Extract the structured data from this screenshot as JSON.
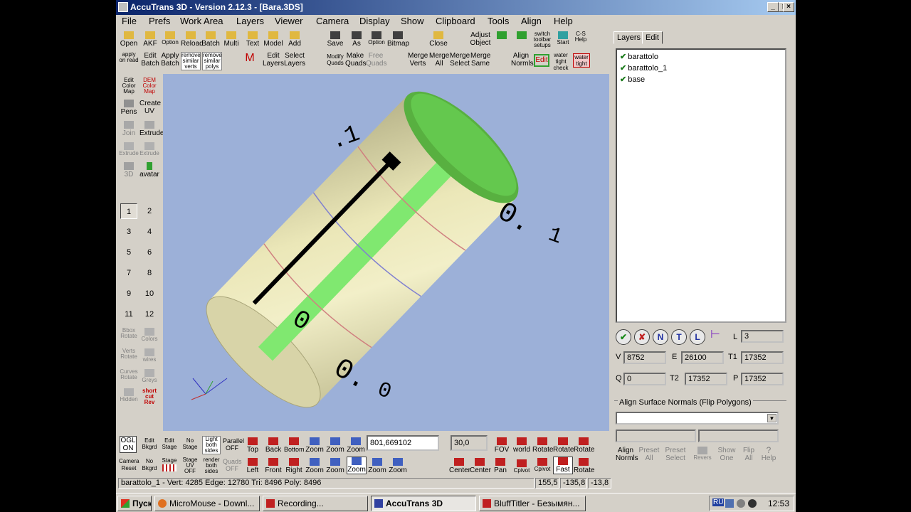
{
  "window": {
    "title": "AccuTrans 3D - Version 2.12.3 - [Bara.3DS]"
  },
  "menu": [
    "File",
    "Prefs",
    "Work Area",
    "Layers",
    "Viewer",
    "Camera",
    "Display",
    "Show",
    "Clipboard",
    "Tools",
    "Align",
    "Help"
  ],
  "toolbar_top_row1": [
    {
      "label": "Open",
      "icon": "folder-icon"
    },
    {
      "label": "AKF",
      "icon": "folder-icon"
    },
    {
      "label": "Option",
      "icon": "folder-icon"
    },
    {
      "label": "Reload",
      "icon": "folder-icon"
    },
    {
      "label": "Batch",
      "icon": "folder-icon"
    },
    {
      "label": "Multi",
      "icon": "folder-icon"
    },
    {
      "label": "Text",
      "icon": "folder-icon"
    },
    {
      "label": "Model",
      "icon": "folder-icon"
    },
    {
      "label": "Add",
      "icon": "folder-icon"
    },
    {
      "label": "Save",
      "icon": "disk-icon"
    },
    {
      "label": "As",
      "icon": "disk-icon"
    },
    {
      "label": "Option",
      "icon": "disk-icon"
    },
    {
      "label": "Bitmap",
      "icon": "disk-icon"
    },
    {
      "label": "Close",
      "icon": "folder-icon"
    },
    {
      "label": "Adjust Object",
      "icon": "adjust-icon"
    },
    {
      "label": "switch toolbar setups",
      "icon": "switch-icon"
    },
    {
      "label": "Start",
      "icon": "start-icon"
    },
    {
      "label": "C-S Help",
      "icon": "help-icon"
    }
  ],
  "toolbar_top_row2": [
    {
      "label": "apply on read"
    },
    {
      "label": "Edit Batch"
    },
    {
      "label": "Apply Batch"
    },
    {
      "label": "remove similar verts"
    },
    {
      "label": "remove similar polys"
    },
    {
      "label": "Edit Layers"
    },
    {
      "label": "Select Layers"
    },
    {
      "label": "Modify Quads"
    },
    {
      "label": "Make Quads"
    },
    {
      "label": "Free Quads"
    },
    {
      "label": "Merge Verts"
    },
    {
      "label": "Merge All"
    },
    {
      "label": "Merge Select"
    },
    {
      "label": "Merge Same"
    },
    {
      "label": "Align Normls"
    },
    {
      "label": "Edit"
    },
    {
      "label": "water tight check"
    },
    {
      "label": "water tight"
    }
  ],
  "left_tools": [
    {
      "label": "Edit Color Map"
    },
    {
      "label": "DEM Color Map"
    },
    {
      "label": "Pens"
    },
    {
      "label": "Create UV"
    },
    {
      "label": "Join"
    },
    {
      "label": "Extrude"
    },
    {
      "label": "Extrude"
    },
    {
      "label": "Extrude"
    },
    {
      "label": "3D"
    },
    {
      "label": "avatar"
    }
  ],
  "view_buttons": [
    "1",
    "2",
    "3",
    "4",
    "5",
    "6",
    "7",
    "8",
    "9",
    "10",
    "11",
    "12"
  ],
  "left_tools_bottom": [
    {
      "label": "Bbox Rotate"
    },
    {
      "label": "Colors"
    },
    {
      "label": "Verts Rotate"
    },
    {
      "label": "wires"
    },
    {
      "label": "Curves Rotate"
    },
    {
      "label": "Greys"
    },
    {
      "label": "Hidden"
    },
    {
      "label": "short cut Rev"
    }
  ],
  "bottom_toolbar_row1": [
    "OGL ON",
    "Edit Bkgrd",
    "Edit Stage",
    "No Stage",
    "Light both sides",
    "Parallel OFF",
    "Top",
    "Back",
    "Bottom",
    "Zoom",
    "Zoom",
    "Zoom"
  ],
  "bottom_toolbar_row2": [
    "Camera Reset",
    "No Bkgrd",
    "Stage",
    "Stage UV OFF",
    "render both sides",
    "Quads OFF",
    "Left",
    "Front",
    "Right",
    "Zoom",
    "Zoom",
    "Zoom",
    "Zoom",
    "Zoom"
  ],
  "bottom_toolbar_right_row1": [
    "FOV",
    "world",
    "Rotate",
    "Rotate",
    "Rotate"
  ],
  "bottom_toolbar_right_row2": [
    "Center",
    "Center",
    "Pan",
    "Cpivot",
    "Cpivot",
    "Fast",
    "Rotate"
  ],
  "coords_field": "801,669102",
  "fov_field": "30,0",
  "panel": {
    "tabs": [
      "Layers",
      "Edit"
    ],
    "layers": [
      "barattolo",
      "barattolo_1",
      "base"
    ],
    "L_label": "L",
    "L_value": "3",
    "V_label": "V",
    "V_value": "8752",
    "E_label": "E",
    "E_value": "26100",
    "T1_label": "T1",
    "T1_value": "17352",
    "Q_label": "Q",
    "Q_value": "0",
    "T2_label": "T2",
    "T2_value": "17352",
    "P_label": "P",
    "P_value": "17352",
    "align_group": "Align Surface Normals (Flip Polygons)",
    "align_buttons": [
      {
        "label": "Align Normls",
        "enabled": true
      },
      {
        "label": "Preset All",
        "enabled": false
      },
      {
        "label": "Preset Select",
        "enabled": false
      },
      {
        "label": "Revers",
        "enabled": false
      },
      {
        "label": "Show One",
        "enabled": false
      },
      {
        "label": "Flip All",
        "enabled": false
      },
      {
        "label": "Help",
        "enabled": false
      }
    ]
  },
  "status": {
    "layer_info": "barattolo_1 - Vert: 4285  Edge: 12780  Tri: 8496  Poly: 8496",
    "x": "155,5",
    "y": "-135,8",
    "z": "-13,8"
  },
  "taskbar": {
    "start": "Пуск",
    "tasks": [
      {
        "label": "MicroMouse - Downl...",
        "active": false
      },
      {
        "label": "Recording...",
        "active": false
      },
      {
        "label": "AccuTrans 3D",
        "active": true
      },
      {
        "label": "BluffTitler - Безымян...",
        "active": false
      }
    ],
    "tray_lang": "RU",
    "clock": "12:53"
  },
  "colors": {
    "viewport_bg": "#9cb0d8",
    "cylinder": "#ece8bc",
    "stripe": "#80e870",
    "cap": "#64c84e",
    "title_start": "#0a246a",
    "title_end": "#a6caf0"
  }
}
